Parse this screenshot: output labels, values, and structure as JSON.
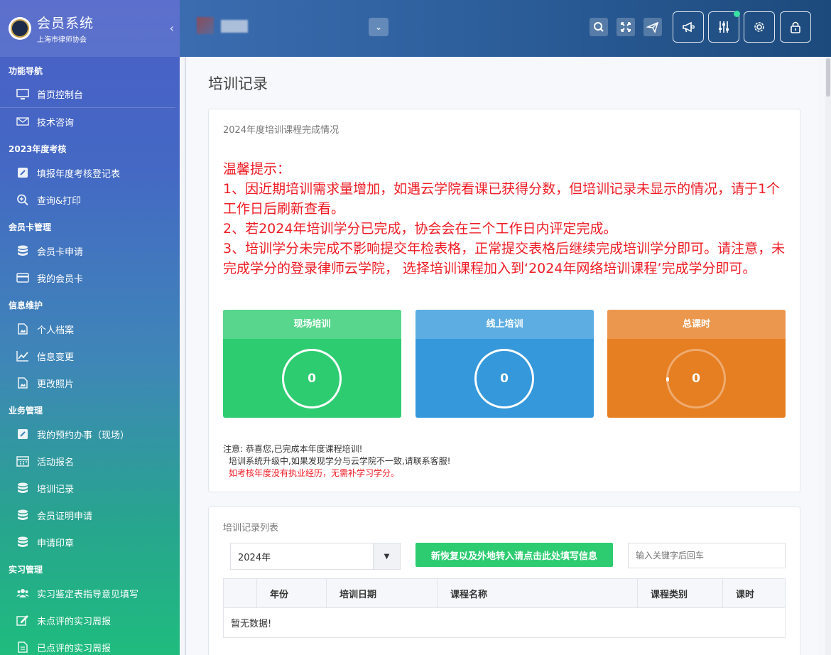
{
  "brand": {
    "title": "会员系统",
    "subtitle": "上海市律师协会"
  },
  "nav": {
    "group1": "功能导航",
    "item_dashboard": "首页控制台",
    "item_consult": "技术咨询",
    "group2": "2023年度考核",
    "item_fill": "填报年度考核登记表",
    "item_query": "查询&打印",
    "group3": "会员卡管理",
    "item_card_apply": "会员卡申请",
    "item_my_card": "我的会员卡",
    "group4": "信息维护",
    "item_profile": "个人档案",
    "item_change": "信息变更",
    "item_photo": "更改照片",
    "group5": "业务管理",
    "item_appoint": "我的预约办事（现场）",
    "item_activity": "活动报名",
    "item_training": "培训记录",
    "item_cert": "会员证明申请",
    "item_seal": "申请印章",
    "group6": "实习管理",
    "item_intern1": "实习鉴定表指导意见填写",
    "item_intern2": "未点评的实习周报",
    "item_intern3": "已点评的实习周报"
  },
  "page": {
    "title": "培训记录"
  },
  "summary": {
    "title": "2024年度培训课程完成情况",
    "notice_head": "温馨提示：",
    "notice_1": "1、因近期培训需求量增加，如遇云学院看课已获得分数，但培训记录未显示的情况，请于1个工作日后刷新查看。",
    "notice_2": "2、若2024年培训学分已完成，协会会在三个工作日内评定完成。",
    "notice_3": "3、培训学分未完成不影响提交年检表格，正常提交表格后继续完成培训学分即可。请注意，未完成学分的登录律师云学院， 选择培训课程加入到‘2024年网络培训课程’完成学分即可。",
    "stats": [
      {
        "label": "现场培训",
        "value": "0"
      },
      {
        "label": "线上培训",
        "value": "0"
      },
      {
        "label": "总课时",
        "value": "0"
      }
    ],
    "note_1": "注意: 恭喜您,已完成本年度课程培训!",
    "note_2": "培训系统升级中,如果发现学分与云学院不一致,请联系客服!",
    "note_3": "如考核年度没有执业经历，无需补学习学分。"
  },
  "records": {
    "title": "培训记录列表",
    "year_select": "2024年",
    "fill_button": "新恢复以及外地转入请点击此处填写信息",
    "search_placeholder": "输入关键字后回车",
    "columns": [
      "",
      "年份",
      "培训日期",
      "课程名称",
      "课程类别",
      "课时"
    ],
    "empty": "暂无数据!"
  }
}
